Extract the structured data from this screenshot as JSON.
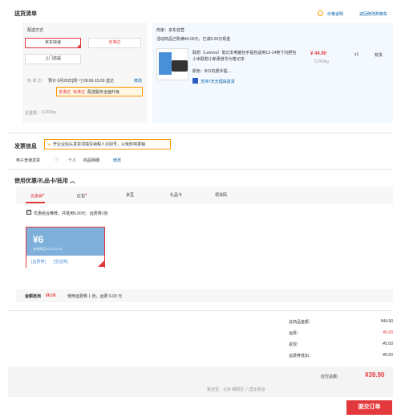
{
  "header": {
    "title": "送货清单",
    "price_note": "价格说明",
    "back_cart": "返回修改购物车"
  },
  "delivery": {
    "label": "配送方式",
    "options": [
      "京东快递",
      "京准达",
      "上门自提"
    ],
    "standard_label": "标 准 达：",
    "standard_text": "预计 6月26日[周一] 09:00-15:00 送达",
    "modify": "修改",
    "badge1": "京准达",
    "badge2": "标准达",
    "upgrade": "配送服务全面升级",
    "weight_label": "总重量：",
    "weight": "0.260kg"
  },
  "shop": {
    "seller": "商家：京东自营",
    "promo": "活动商品已购满44.00元，已减5.00元现金",
    "product_name": "联想（Lenovo）笔记本电脑包手提包适用13-14英寸内胆包小米联想小新惠普华为笔记本",
    "color": "颜色：B11内胆手提...",
    "support": "支持7天无理由退货",
    "price": "¥ 44.90",
    "qty": "x1",
    "stock": "有货",
    "weight": "0.260kg"
  },
  "invoice": {
    "title": "发票信息",
    "notice": "开企业抬头发票须填写纳税人识别号，以免影响报销",
    "type": "电子普通发票",
    "personal": "个人",
    "detail": "商品明细",
    "modify": "修改"
  },
  "coupon": {
    "title": "使用优惠/礼品卡/抵用",
    "tabs": [
      "优惠券",
      "红包",
      "京豆",
      "礼品卡",
      "领货码"
    ],
    "combo": "优惠组合推荐，共抵用6.00元：运费券1张",
    "amount": "¥6",
    "expire": "有效期至2023-07-08",
    "type1": "[运费券]",
    "type2": "[全品类]",
    "bottom_label": "金额抵用",
    "bottom_amount": "¥6.00",
    "bottom_detail": "使用运费券 1 张，运费 6.00 元"
  },
  "summary": {
    "total_label": "总商品金额：",
    "total": "¥44.90",
    "freight_label": "运费：",
    "freight": "¥6.00",
    "discount_label": "返现：",
    "discount": "-¥5.00",
    "coupon_label": "运费券抵扣：",
    "coupon": "-¥6.00",
    "payable_label": "应付总额：",
    "payable": "¥39.90",
    "address_label": "寄送至：",
    "address": "北京 朝阳区 八里庄街道",
    "submit": "提交订单"
  },
  "colors": {
    "accent": "#e4393c",
    "blue": "#005ea7",
    "panel": "#f3f9ff",
    "left_panel": "#f7f7f7"
  }
}
